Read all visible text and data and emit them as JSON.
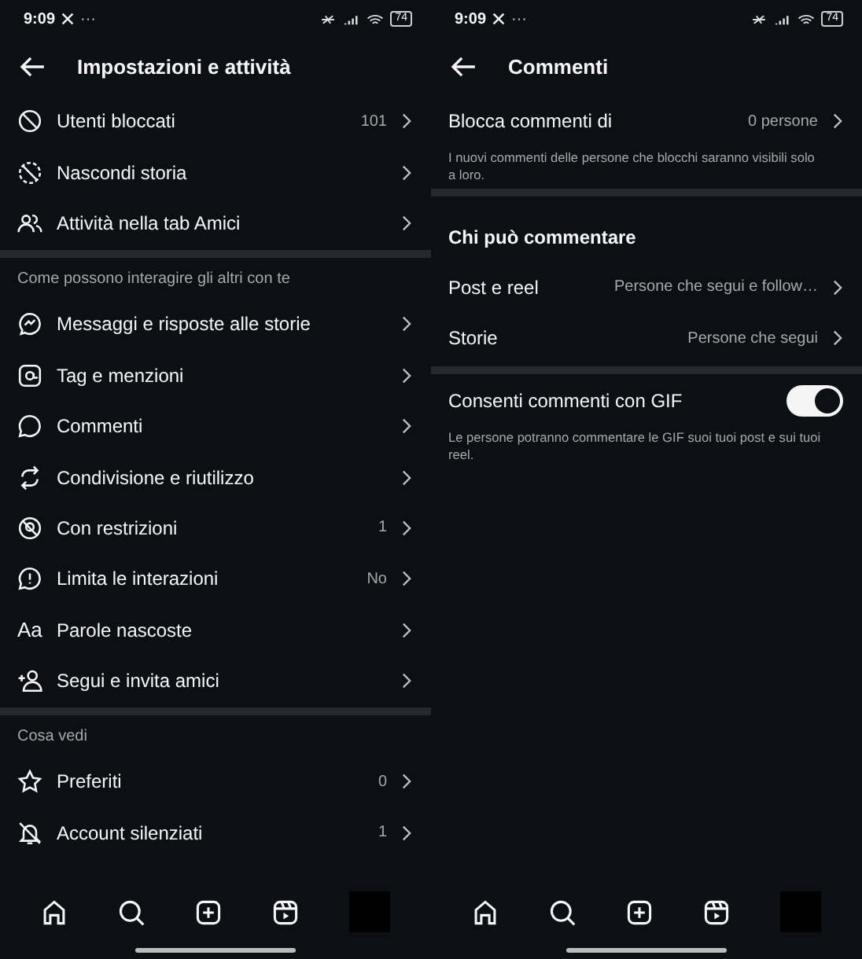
{
  "left": {
    "status_bar": {
      "time": "9:09",
      "more": "···",
      "battery": "74"
    },
    "title": "Impostazioni e attività",
    "sections": [
      {
        "items": [
          {
            "label": "Utenti bloccati",
            "value": "101"
          },
          {
            "label": "Nascondi storia"
          },
          {
            "label": "Attività nella tab Amici"
          }
        ]
      },
      {
        "label": "Come possono interagire gli altri con te",
        "items": [
          {
            "label": "Messaggi e risposte alle storie"
          },
          {
            "label": "Tag e menzioni"
          },
          {
            "label": "Commenti"
          },
          {
            "label": "Condivisione e riutilizzo"
          },
          {
            "label": "Con restrizioni",
            "value": "1"
          },
          {
            "label": "Limita le interazioni",
            "value": "No"
          },
          {
            "label": "Parole nascoste",
            "glyph": "Aa"
          },
          {
            "label": "Segui e invita amici"
          }
        ]
      },
      {
        "label": "Cosa vedi",
        "items": [
          {
            "label": "Preferiti",
            "value": "0"
          },
          {
            "label": "Account silenziati",
            "value": "1"
          }
        ]
      }
    ]
  },
  "right": {
    "status_bar": {
      "time": "9:09",
      "more": "···",
      "battery": "74"
    },
    "title": "Commenti",
    "rows": [
      {
        "kind": "link",
        "label": "Blocca commenti di",
        "value": "0 persone"
      },
      {
        "kind": "note",
        "text": "I nuovi commenti delle persone che blocchi saranno visibili solo a loro."
      },
      {
        "kind": "divider"
      },
      {
        "kind": "heading",
        "text": "Chi può commentare"
      },
      {
        "kind": "link",
        "label": "Post e reel",
        "value": "Persone che segui e follow…"
      },
      {
        "kind": "link",
        "label": "Storie",
        "value": "Persone che segui"
      },
      {
        "kind": "divider"
      },
      {
        "kind": "toggle",
        "label": "Consenti commenti con GIF",
        "on": true
      },
      {
        "kind": "note",
        "text": "Le persone potranno commentare le GIF suoi tuoi post e sui tuoi reel."
      }
    ]
  }
}
